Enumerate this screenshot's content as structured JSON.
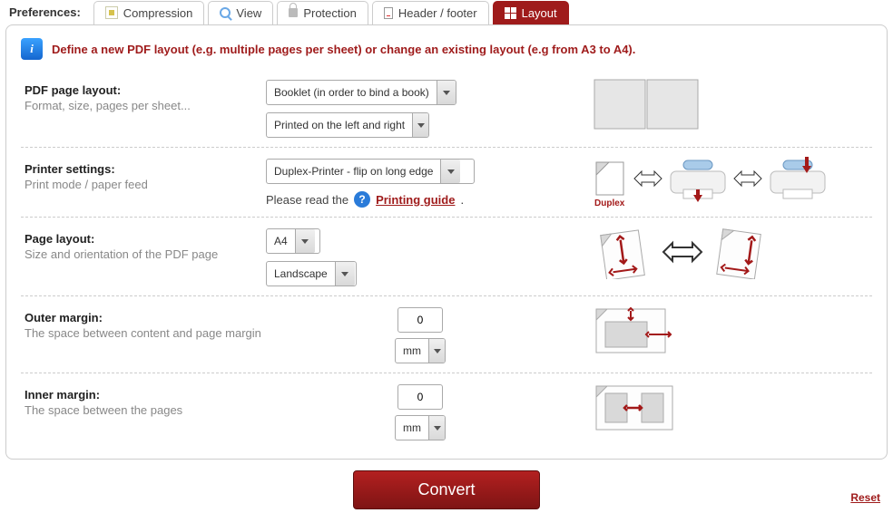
{
  "header": {
    "prefLabel": "Preferences:"
  },
  "tabs": [
    {
      "label": "Compression",
      "active": false
    },
    {
      "label": "View",
      "active": false
    },
    {
      "label": "Protection",
      "active": false
    },
    {
      "label": "Header / footer",
      "active": false
    },
    {
      "label": "Layout",
      "active": true
    }
  ],
  "info": {
    "text": "Define a new PDF layout (e.g. multiple pages per sheet) or change an existing layout (e.g from A3 to A4)."
  },
  "sections": {
    "pdfLayout": {
      "title": "PDF page layout:",
      "sub": "Format, size, pages per sheet...",
      "layoutSelect": "Booklet (in order to bind a book)",
      "sideSelect": "Printed on the left and right"
    },
    "printer": {
      "title": "Printer settings:",
      "sub": "Print mode / paper feed",
      "select": "Duplex-Printer - flip on long edge",
      "hintPrefix": "Please read the",
      "linkText": "Printing guide",
      "linkSuffix": ".",
      "duplexLabel": "Duplex"
    },
    "pageLayout": {
      "title": "Page layout:",
      "sub": "Size and orientation of the PDF page",
      "sizeSelect": "A4",
      "orientSelect": "Landscape"
    },
    "outerMargin": {
      "title": "Outer margin:",
      "sub": "The space between content and page margin",
      "value": "0",
      "unit": "mm"
    },
    "innerMargin": {
      "title": "Inner margin:",
      "sub": "The space between the pages",
      "value": "0",
      "unit": "mm"
    }
  },
  "footer": {
    "convert": "Convert",
    "reset": "Reset"
  }
}
